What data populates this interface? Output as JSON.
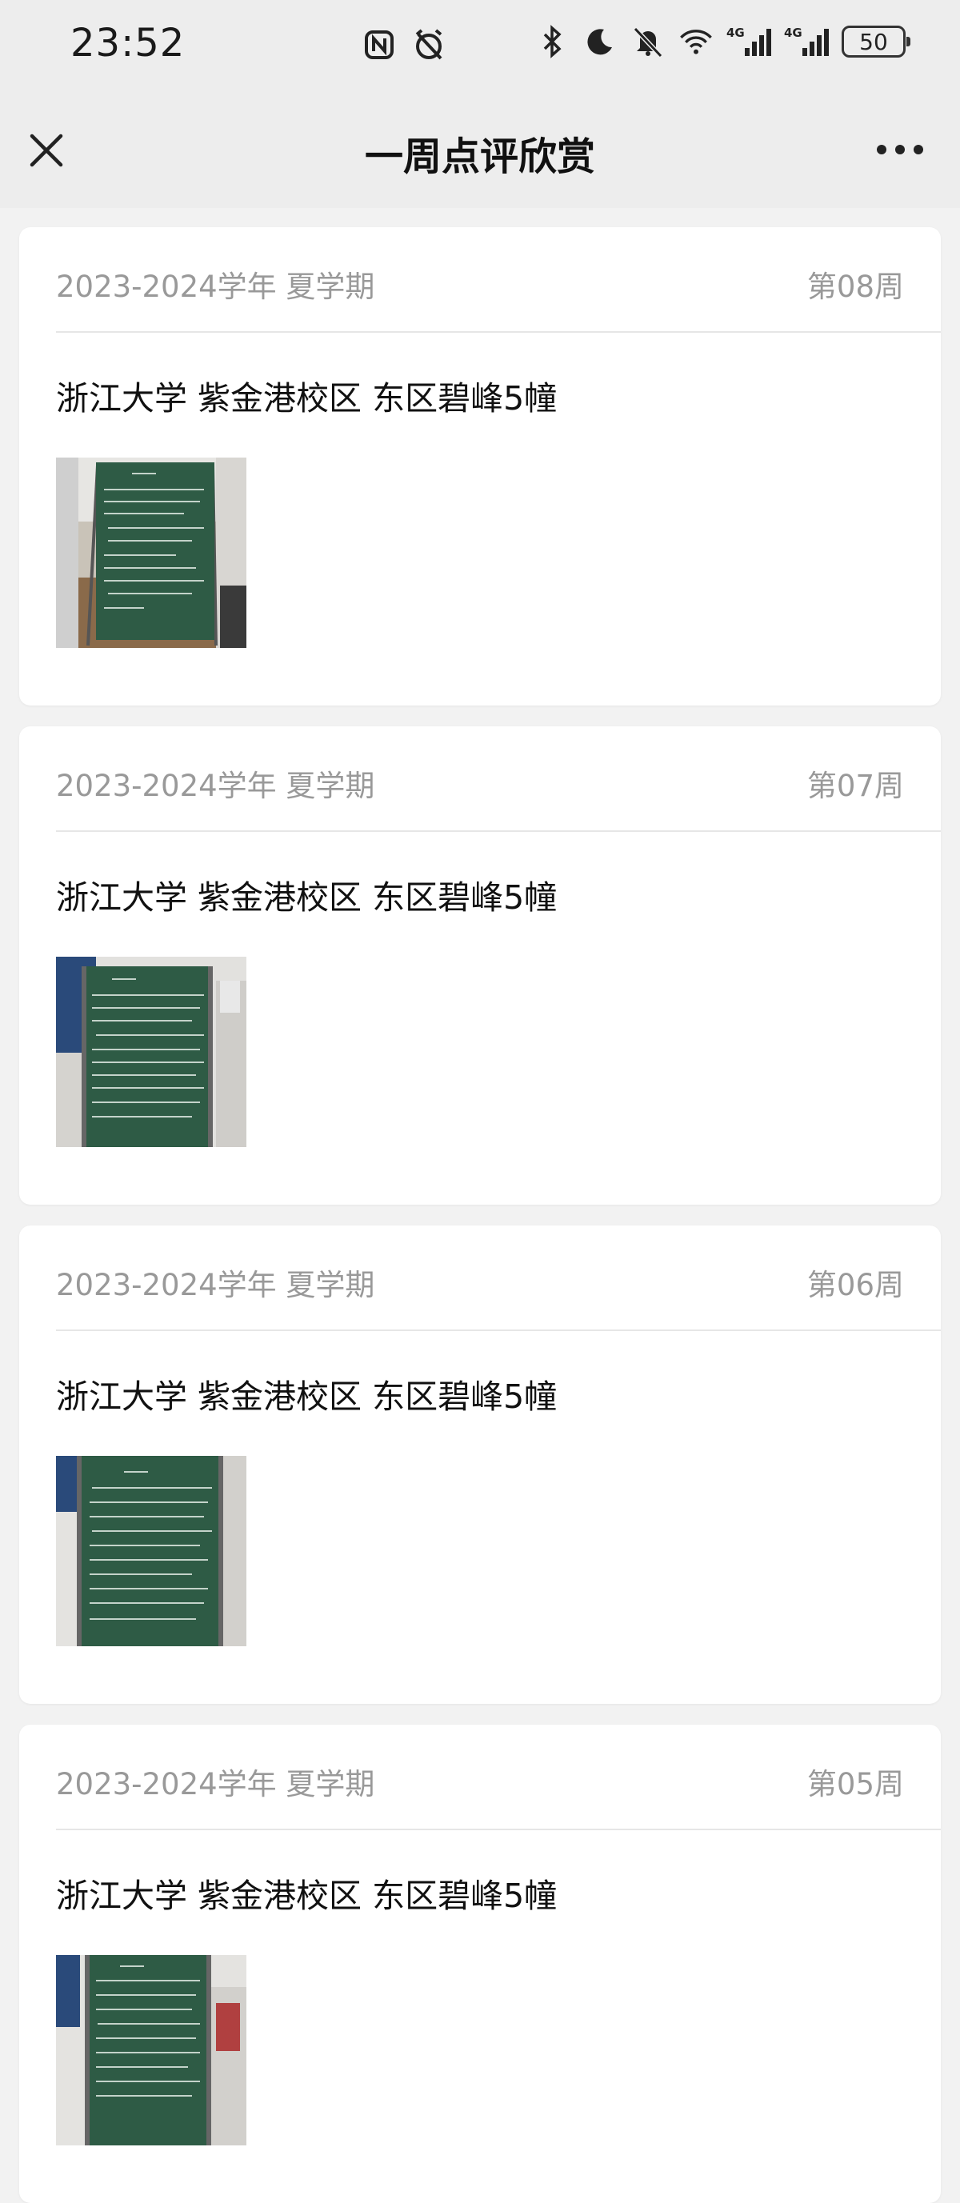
{
  "status_bar": {
    "time": "23:52",
    "network_tags": [
      "4G",
      "4G"
    ],
    "battery": "50"
  },
  "nav": {
    "title": "一周点评欣赏"
  },
  "cards": [
    {
      "term": "2023-2024学年 夏学期",
      "week": "第08周",
      "location": "浙江大学 紫金港校区 东区碧峰5幢"
    },
    {
      "term": "2023-2024学年 夏学期",
      "week": "第07周",
      "location": "浙江大学 紫金港校区 东区碧峰5幢"
    },
    {
      "term": "2023-2024学年 夏学期",
      "week": "第06周",
      "location": "浙江大学 紫金港校区 东区碧峰5幢"
    },
    {
      "term": "2023-2024学年 夏学期",
      "week": "第05周",
      "location": "浙江大学 紫金港校区 东区碧峰5幢"
    }
  ],
  "colors": {
    "header_bg": "#ededed",
    "page_bg": "#f2f2f2",
    "card_bg": "#ffffff",
    "muted_text": "#999999",
    "chalkboard": "#2e5b45"
  }
}
